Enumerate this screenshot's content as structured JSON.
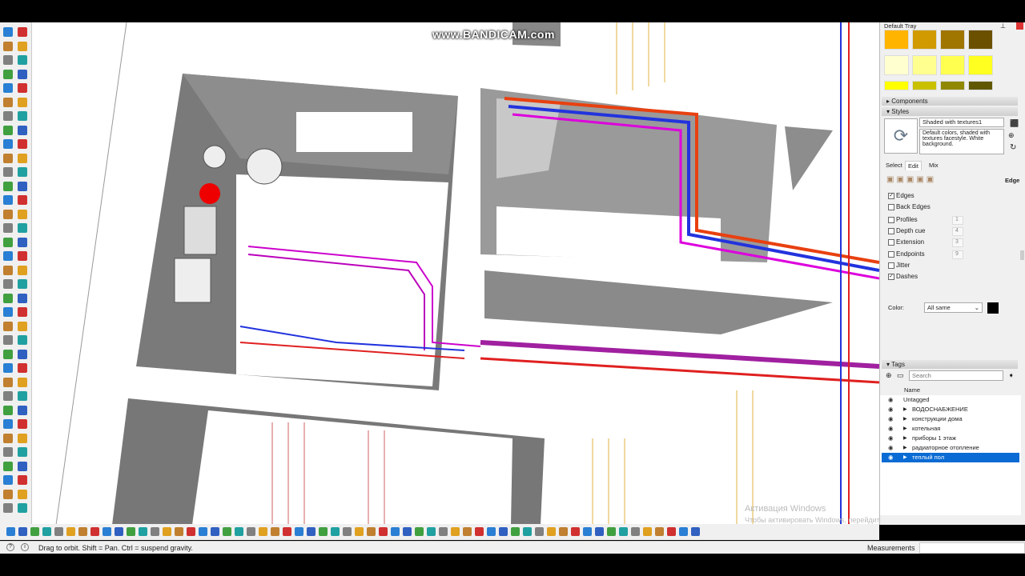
{
  "watermark": "www.BANDICAM.com",
  "activation": {
    "title": "Активация Windows",
    "subtitle": "Чтобы активировать Windows, перейдите в раздел \"Параметры\""
  },
  "status": {
    "message": "Drag to orbit. Shift = Pan. Ctrl = suspend gravity.",
    "measurements_label": "Measurements",
    "measurements_value": ""
  },
  "tray": {
    "title": "Default Tray",
    "swatches": [
      "#ffb400",
      "#d09a00",
      "#a07500",
      "#6b5000",
      "#ffffd0",
      "#ffff90",
      "#ffff50",
      "#ffff20",
      "#ffff00",
      "#c8c000",
      "#908800",
      "#605800"
    ],
    "components_label": "Components",
    "styles_label": "Styles",
    "style_name": "Shaded with textures1",
    "style_desc": "Default colors, shaded with textures facestyle. White background.",
    "tabs": [
      "Select",
      "Edit",
      "Mix"
    ],
    "section": "Edge",
    "edge_options": [
      {
        "label": "Edges",
        "checked": true
      },
      {
        "label": "Back Edges",
        "checked": false
      },
      {
        "label": "Profiles",
        "checked": false,
        "value": "1"
      },
      {
        "label": "Depth cue",
        "checked": false,
        "value": "4"
      },
      {
        "label": "Extension",
        "checked": false,
        "value": "3"
      },
      {
        "label": "Endpoints",
        "checked": false,
        "value": "9"
      },
      {
        "label": "Jitter",
        "checked": false
      },
      {
        "label": "Dashes",
        "checked": true
      }
    ],
    "color_label": "Color:",
    "color_value": "All same",
    "tags_label": "Tags",
    "search_placeholder": "Search",
    "name_header": "Name",
    "tags": [
      {
        "name": "Untagged",
        "expandable": false,
        "selected": false
      },
      {
        "name": "ВОДОСНАБЖЕНИЕ",
        "expandable": true,
        "selected": false
      },
      {
        "name": "конструкции дома",
        "expandable": true,
        "selected": false
      },
      {
        "name": "котельная",
        "expandable": true,
        "selected": false
      },
      {
        "name": "приборы 1 этаж",
        "expandable": true,
        "selected": false
      },
      {
        "name": "радиаторное отопление",
        "expandable": true,
        "selected": false
      },
      {
        "name": "теплый пол",
        "expandable": true,
        "selected": true
      }
    ]
  }
}
